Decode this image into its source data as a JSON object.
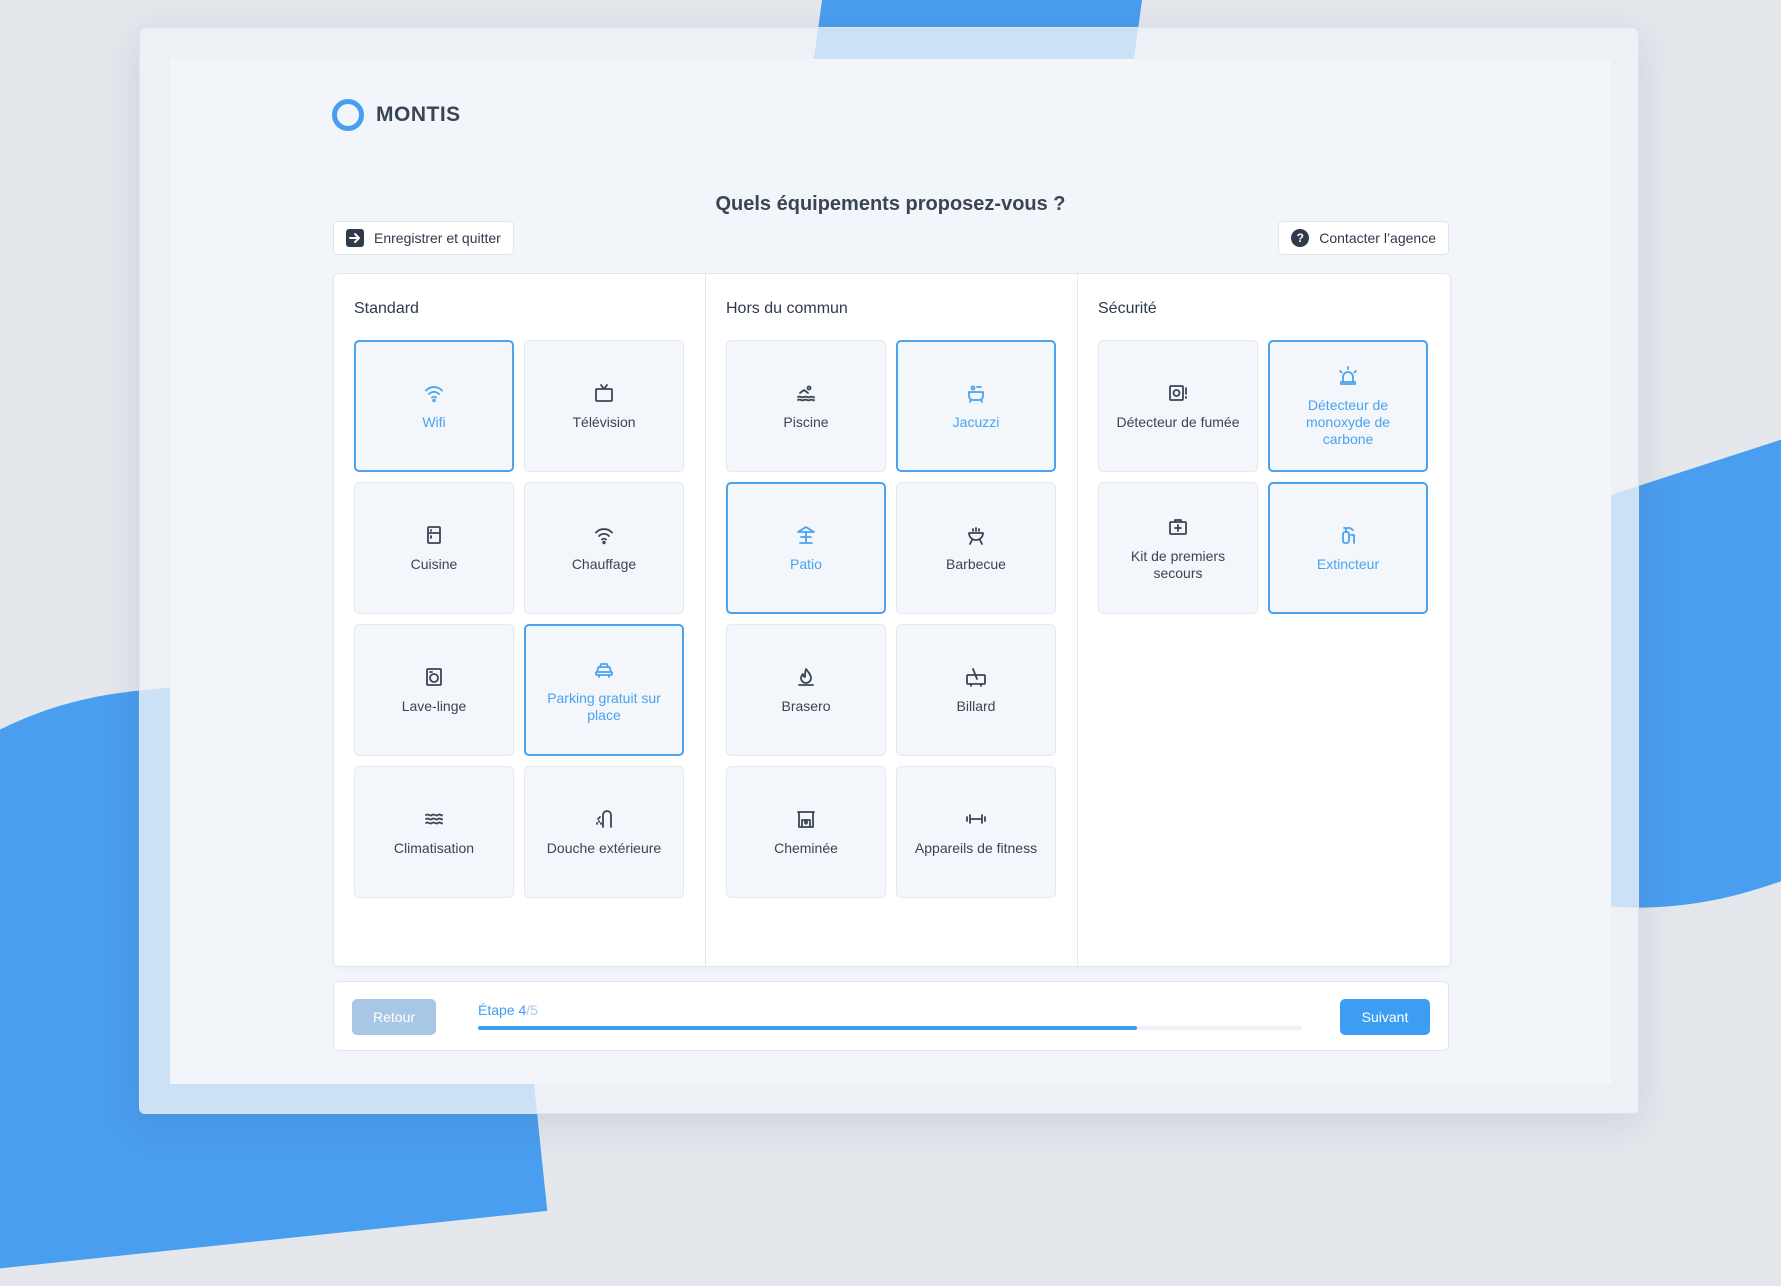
{
  "brand": {
    "name": "MONTIS"
  },
  "title": "Quels équipements proposez-vous ?",
  "actions": {
    "save_quit": "Enregistrer et quitter",
    "contact": "Contacter l’agence"
  },
  "columns": [
    {
      "title": "Standard",
      "items": [
        {
          "label": "Wifi",
          "icon": "wifi-icon",
          "selected": true
        },
        {
          "label": "Télévision",
          "icon": "tv-icon",
          "selected": false
        },
        {
          "label": "Cuisine",
          "icon": "fridge-icon",
          "selected": false
        },
        {
          "label": "Chauffage",
          "icon": "wifi-icon",
          "selected": false
        },
        {
          "label": "Lave-linge",
          "icon": "washing-machine-icon",
          "selected": false
        },
        {
          "label": "Parking gratuit sur place",
          "icon": "car-icon",
          "selected": true
        },
        {
          "label": "Climatisation",
          "icon": "waves-icon",
          "selected": false
        },
        {
          "label": "Douche extérieure",
          "icon": "shower-icon",
          "selected": false
        }
      ]
    },
    {
      "title": "Hors du commun",
      "items": [
        {
          "label": "Piscine",
          "icon": "swimmer-icon",
          "selected": false
        },
        {
          "label": "Jacuzzi",
          "icon": "jacuzzi-icon",
          "selected": true
        },
        {
          "label": "Patio",
          "icon": "patio-icon",
          "selected": true
        },
        {
          "label": "Barbecue",
          "icon": "grill-icon",
          "selected": false
        },
        {
          "label": "Brasero",
          "icon": "flame-icon",
          "selected": false
        },
        {
          "label": "Billard",
          "icon": "billiard-icon",
          "selected": false
        },
        {
          "label": "Cheminée",
          "icon": "fireplace-icon",
          "selected": false
        },
        {
          "label": "Appareils de fitness",
          "icon": "dumbbell-icon",
          "selected": false
        }
      ]
    },
    {
      "title": "Sécurité",
      "items": [
        {
          "label": "Détecteur de fumée",
          "icon": "smoke-detector-icon",
          "selected": false
        },
        {
          "label": "Détecteur de monoxyde de carbone",
          "icon": "alarm-icon",
          "selected": true
        },
        {
          "label": "Kit de premiers secours",
          "icon": "first-aid-icon",
          "selected": false
        },
        {
          "label": "Extincteur",
          "icon": "extinguisher-icon",
          "selected": true
        }
      ]
    }
  ],
  "footer": {
    "back": "Retour",
    "next": "Suivant",
    "step_label": "Étape 4",
    "step_total": "/5",
    "progress": 0.8
  },
  "colors": {
    "accent": "#3d9df0",
    "selected_border": "#4aa3ee",
    "back_disabled": "#a8c7e7"
  }
}
